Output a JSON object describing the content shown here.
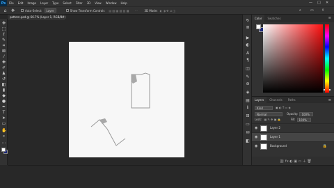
{
  "app": {
    "logo": "Ps"
  },
  "menu": [
    "File",
    "Edit",
    "Image",
    "Layer",
    "Type",
    "Select",
    "Filter",
    "3D",
    "View",
    "Window",
    "Help"
  ],
  "window_controls": {
    "minimize": "—",
    "maximize": "□",
    "close": "✕"
  },
  "options": {
    "auto_select_label": "Auto-Select:",
    "auto_select_value": "Layer",
    "transform_controls_label": "Show Transform Controls",
    "mode_3d_label": "3D Mode:"
  },
  "document_tab": {
    "title": "pattern.psd @ 66.7% (Layer 1, RGB/8#)",
    "close": "×"
  },
  "color_panel": {
    "tabs": [
      "Color",
      "Swatches"
    ],
    "foreground": "#ffffff",
    "background": "#1e2a7a"
  },
  "layers_panel": {
    "tabs": [
      "Layers",
      "Channels",
      "Paths"
    ],
    "filter_label": "Kind",
    "blend_mode": "Normal",
    "opacity_label": "Opacity:",
    "opacity_value": "100%",
    "lock_label": "Lock:",
    "fill_label": "Fill:",
    "fill_value": "100%",
    "layers": [
      {
        "name": "Layer 2",
        "selected": false,
        "locked": false
      },
      {
        "name": "Layer 1",
        "selected": true,
        "locked": false
      },
      {
        "name": "Background",
        "selected": false,
        "locked": true
      }
    ]
  },
  "icons": {
    "panel_menu": "≡",
    "eye": "◉",
    "lock": "🔒"
  }
}
